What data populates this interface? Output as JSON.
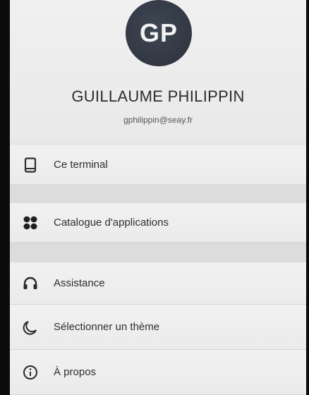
{
  "profile": {
    "initials": "GP",
    "name": "GUILLAUME PHILIPPIN",
    "email": "gphilippin@seay.fr"
  },
  "menu": {
    "items": [
      {
        "label": "Ce terminal",
        "icon": "device-icon"
      },
      {
        "label": "Catalogue d'applications",
        "icon": "apps-icon"
      },
      {
        "label": "Assistance",
        "icon": "headset-icon"
      },
      {
        "label": "Sélectionner un thème",
        "icon": "moon-icon"
      },
      {
        "label": "À propos",
        "icon": "info-icon"
      }
    ]
  },
  "colors": {
    "avatar_bg": "#333a45",
    "text": "#2e2e2e"
  }
}
